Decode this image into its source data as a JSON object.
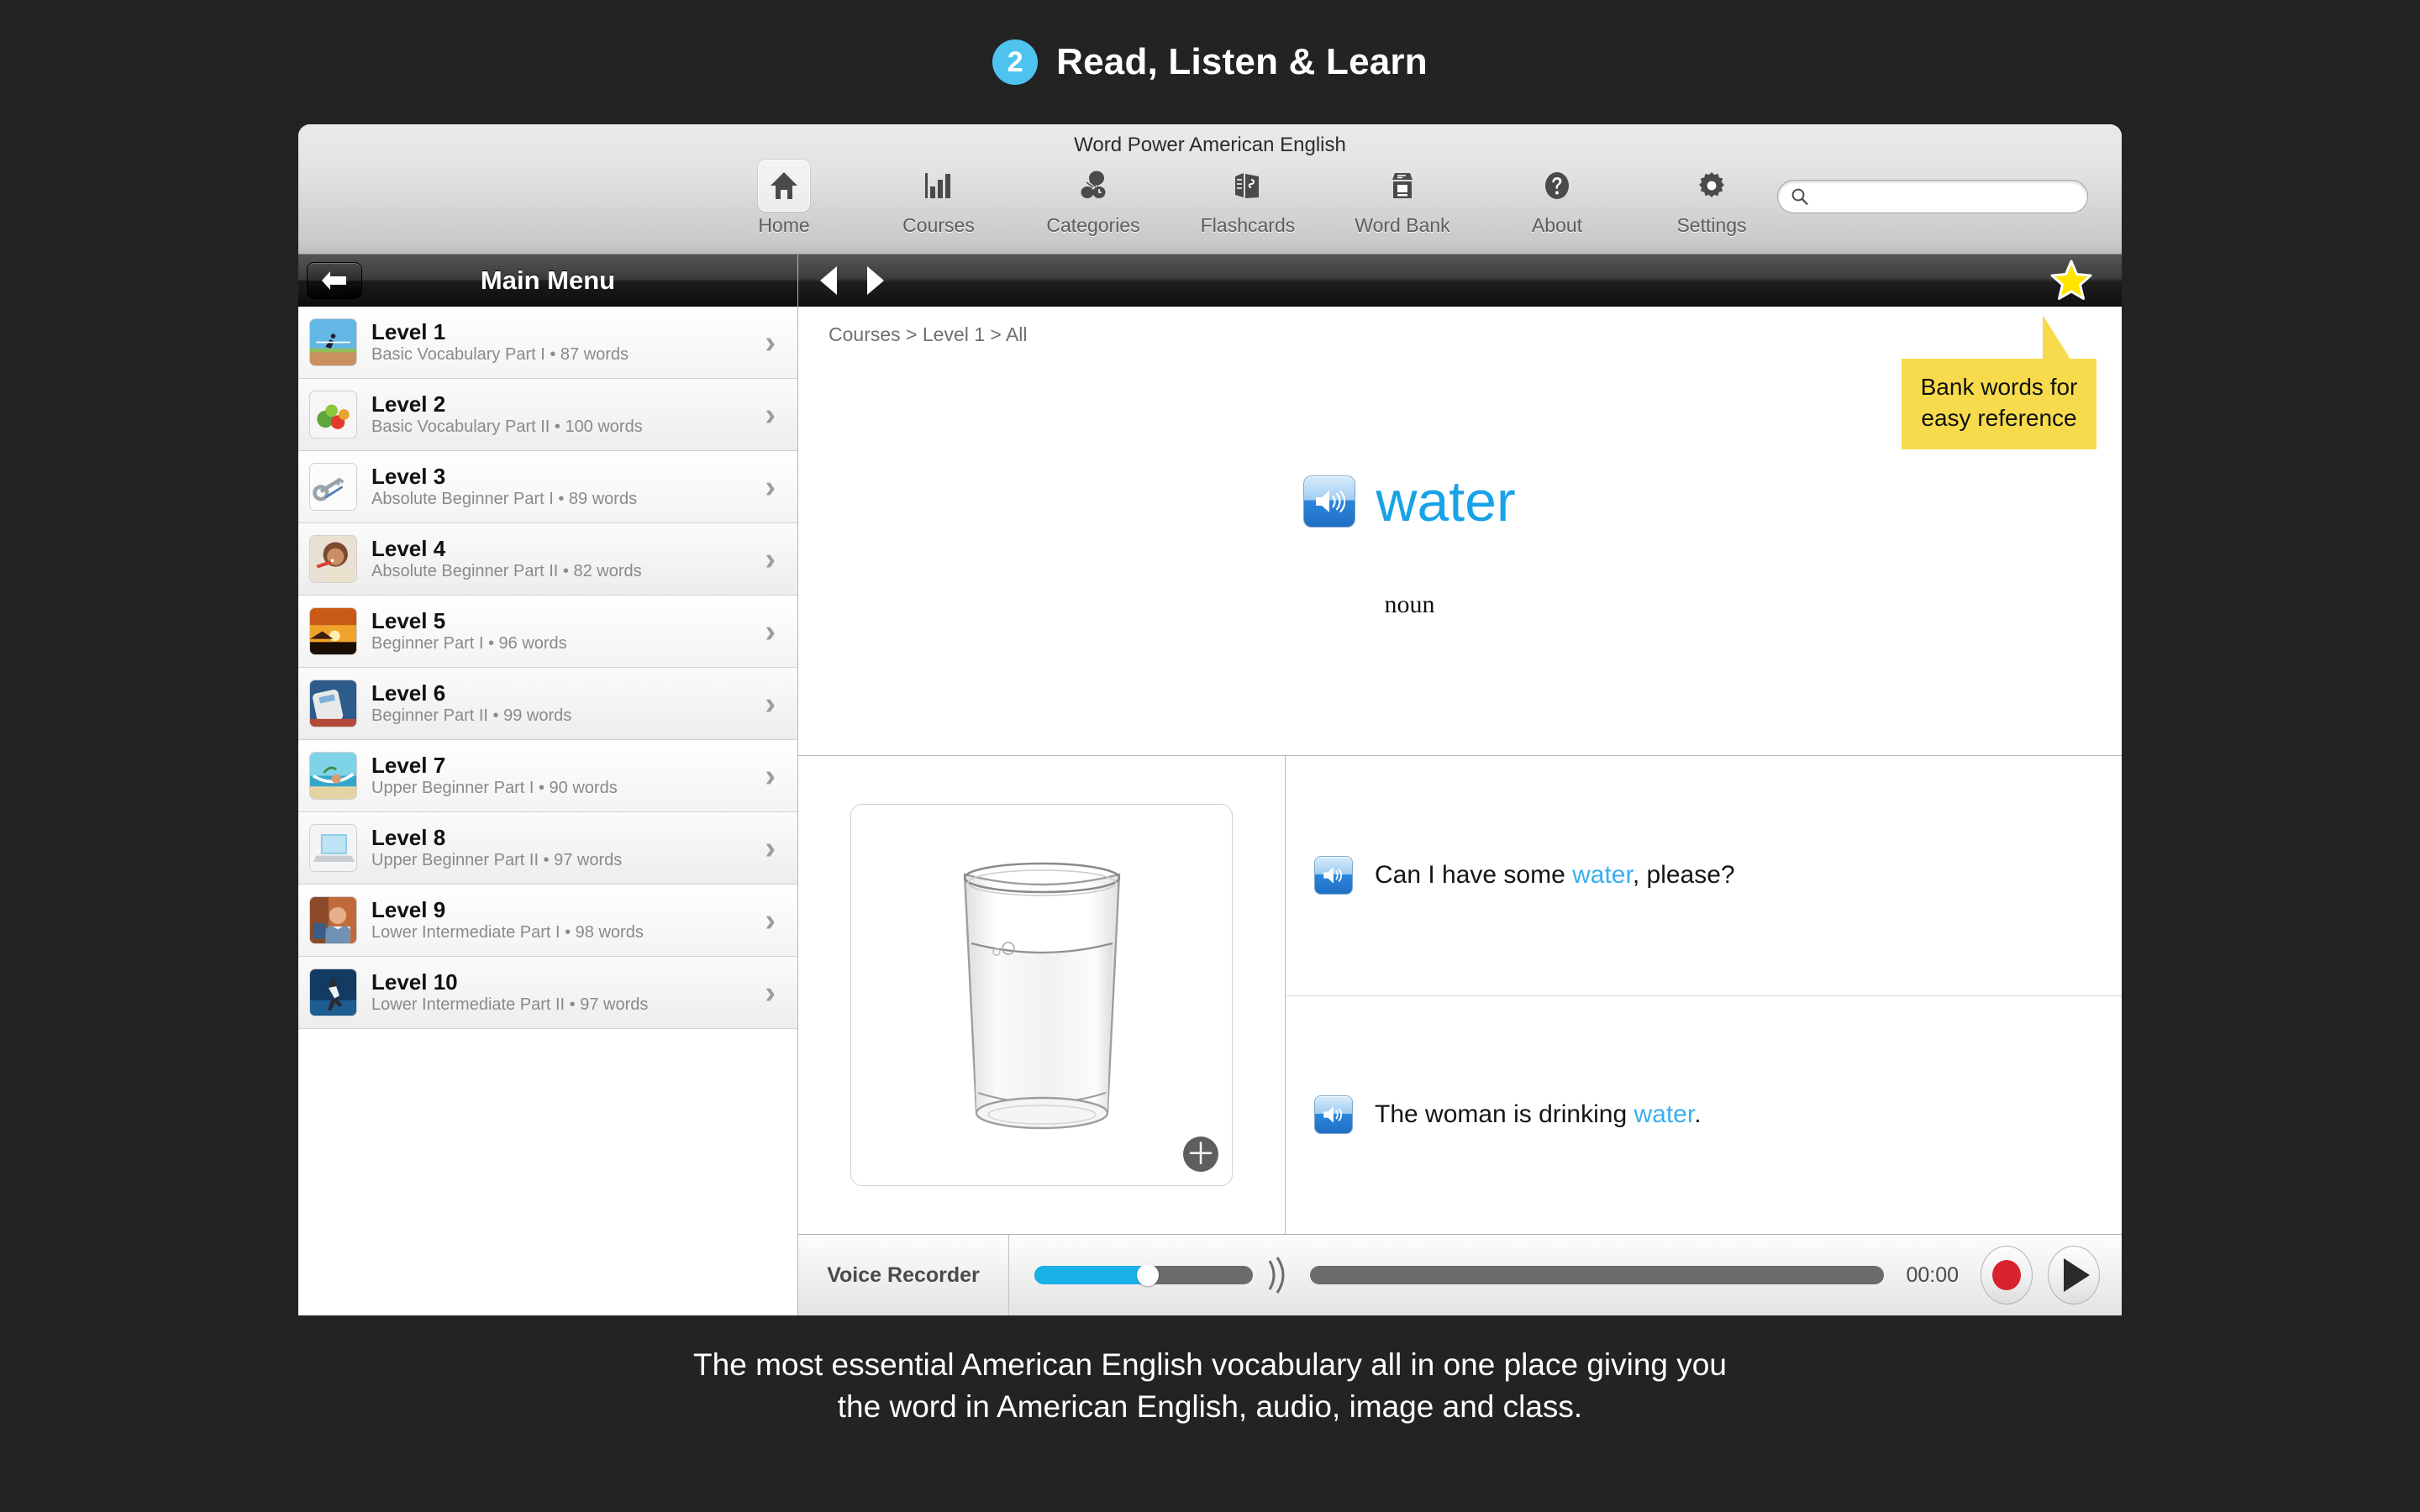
{
  "banner": {
    "step_number": "2",
    "title": "Read, Listen & Learn"
  },
  "window": {
    "app_title": "Word Power American English"
  },
  "toolbar": {
    "items": [
      {
        "label": "Home",
        "icon": "home-icon",
        "selected": true
      },
      {
        "label": "Courses",
        "icon": "bar-chart-icon",
        "selected": false
      },
      {
        "label": "Categories",
        "icon": "categories-icon",
        "selected": false
      },
      {
        "label": "Flashcards",
        "icon": "flashcards-icon",
        "selected": false
      },
      {
        "label": "Word Bank",
        "icon": "word-bank-icon",
        "selected": false
      },
      {
        "label": "About",
        "icon": "question-mark-icon",
        "selected": false
      },
      {
        "label": "Settings",
        "icon": "gear-icon",
        "selected": false
      }
    ],
    "search": {
      "value": "",
      "placeholder": "",
      "icon": "search-icon"
    }
  },
  "sidebar": {
    "title": "Main Menu",
    "back_icon": "back-arrow-icon",
    "levels": [
      {
        "name": "Level 1",
        "sub": "Basic Vocabulary Part I • 87 words",
        "thumb": "athlete-hurdle-photo"
      },
      {
        "name": "Level 2",
        "sub": "Basic Vocabulary Part II • 100 words",
        "thumb": "vegetables-photo"
      },
      {
        "name": "Level 3",
        "sub": "Absolute Beginner Part I • 89 words",
        "thumb": "keys-photo"
      },
      {
        "name": "Level 4",
        "sub": "Absolute Beginner Part II • 82 words",
        "thumb": "woman-toothbrush-photo"
      },
      {
        "name": "Level 5",
        "sub": "Beginner Part I • 96 words",
        "thumb": "sunset-photo"
      },
      {
        "name": "Level 6",
        "sub": "Beginner Part II • 99 words",
        "thumb": "remote-control-photo"
      },
      {
        "name": "Level 7",
        "sub": "Upper Beginner Part I • 90 words",
        "thumb": "beach-hammock-photo"
      },
      {
        "name": "Level 8",
        "sub": "Upper Beginner Part II • 97 words",
        "thumb": "laptop-photo"
      },
      {
        "name": "Level 9",
        "sub": "Lower Intermediate Part I • 98 words",
        "thumb": "man-classroom-photo"
      },
      {
        "name": "Level 10",
        "sub": "Lower Intermediate Part II • 97 words",
        "thumb": "runner-track-photo"
      }
    ],
    "chevron": "›"
  },
  "main": {
    "nav": {
      "prev_icon": "left-triangle-icon",
      "next_icon": "right-triangle-icon",
      "star_icon": "star-icon"
    },
    "breadcrumb": "Courses > Level 1 > All",
    "word": "water",
    "part_of_speech": "noun",
    "speaker_icon": "speaker-icon",
    "callout": "Bank words for easy reference",
    "image": {
      "alt": "glass-of-water-photo",
      "zoom_badge": "＋"
    },
    "sentences": [
      {
        "before": "Can I have some ",
        "highlight": "water",
        "after": ", please?"
      },
      {
        "before": "The woman is drinking ",
        "highlight": "water",
        "after": "."
      }
    ]
  },
  "recorder": {
    "label": "Voice Recorder",
    "volume_percent": 52,
    "time": "00:00",
    "record_label": "record-button",
    "play_label": "play-button"
  },
  "caption": {
    "line1": "The most essential American English vocabulary all in one place giving you",
    "line2": "the word in American English, audio, image and class."
  },
  "colors": {
    "accent_blue": "#18a3e8",
    "callout_yellow": "#f7db4d",
    "star_yellow": "#ffe400",
    "record_red": "#d8232f",
    "page_bg": "#232323"
  }
}
